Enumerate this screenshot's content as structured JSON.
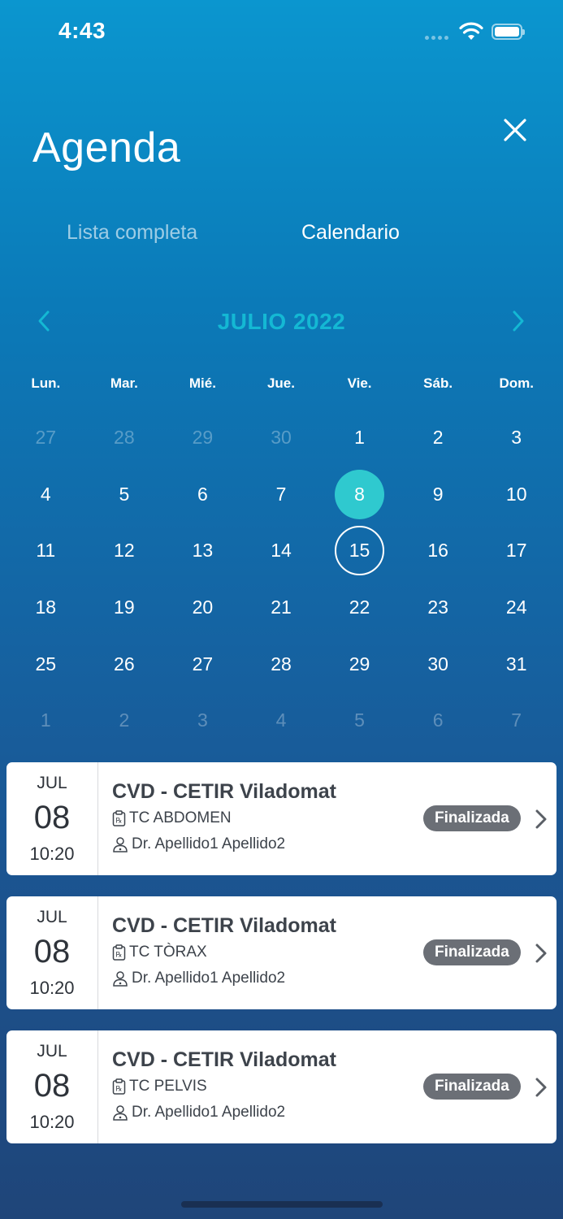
{
  "status_bar": {
    "time": "4:43",
    "battery_level": 1.0
  },
  "header": {
    "title": "Agenda",
    "close_icon": "close-icon"
  },
  "tabs": [
    {
      "label": "Lista completa",
      "active": false
    },
    {
      "label": "Calendario",
      "active": true
    }
  ],
  "calendar": {
    "month_label": "JULIO 2022",
    "weekdays": [
      "Lun.",
      "Mar.",
      "Mié.",
      "Jue.",
      "Vie.",
      "Sáb.",
      "Dom."
    ],
    "days": [
      {
        "label": "27",
        "muted": true
      },
      {
        "label": "28",
        "muted": true
      },
      {
        "label": "29",
        "muted": true
      },
      {
        "label": "30",
        "muted": true
      },
      {
        "label": "1"
      },
      {
        "label": "2"
      },
      {
        "label": "3"
      },
      {
        "label": "4"
      },
      {
        "label": "5"
      },
      {
        "label": "6"
      },
      {
        "label": "7"
      },
      {
        "label": "8",
        "selected": true
      },
      {
        "label": "9"
      },
      {
        "label": "10"
      },
      {
        "label": "11"
      },
      {
        "label": "12"
      },
      {
        "label": "13"
      },
      {
        "label": "14"
      },
      {
        "label": "15",
        "marked": true
      },
      {
        "label": "16"
      },
      {
        "label": "17"
      },
      {
        "label": "18"
      },
      {
        "label": "19"
      },
      {
        "label": "20"
      },
      {
        "label": "21"
      },
      {
        "label": "22"
      },
      {
        "label": "23"
      },
      {
        "label": "24"
      },
      {
        "label": "25"
      },
      {
        "label": "26"
      },
      {
        "label": "27"
      },
      {
        "label": "28"
      },
      {
        "label": "29"
      },
      {
        "label": "30"
      },
      {
        "label": "31"
      },
      {
        "label": "1",
        "muted": true
      },
      {
        "label": "2",
        "muted": true
      },
      {
        "label": "3",
        "muted": true
      },
      {
        "label": "4",
        "muted": true
      },
      {
        "label": "5",
        "muted": true
      },
      {
        "label": "6",
        "muted": true
      },
      {
        "label": "7",
        "muted": true
      }
    ]
  },
  "appointments": [
    {
      "month": "JUL",
      "day": "08",
      "time": "10:20",
      "center": "CVD - CETIR Viladomat",
      "procedure": "TC ABDOMEN",
      "doctor": "Dr. Apellido1 Apellido2",
      "status": "Finalizada"
    },
    {
      "month": "JUL",
      "day": "08",
      "time": "10:20",
      "center": "CVD - CETIR Viladomat",
      "procedure": "TC TÒRAX",
      "doctor": "Dr. Apellido1 Apellido2",
      "status": "Finalizada"
    },
    {
      "month": "JUL",
      "day": "08",
      "time": "10:20",
      "center": "CVD - CETIR Viladomat",
      "procedure": "TC PELVIS",
      "doctor": "Dr. Apellido1 Apellido2",
      "status": "Finalizada"
    }
  ],
  "colors": {
    "accent": "#14b8d4",
    "selected_day": "#2fc9cf",
    "status_badge": "#6b6f76"
  }
}
